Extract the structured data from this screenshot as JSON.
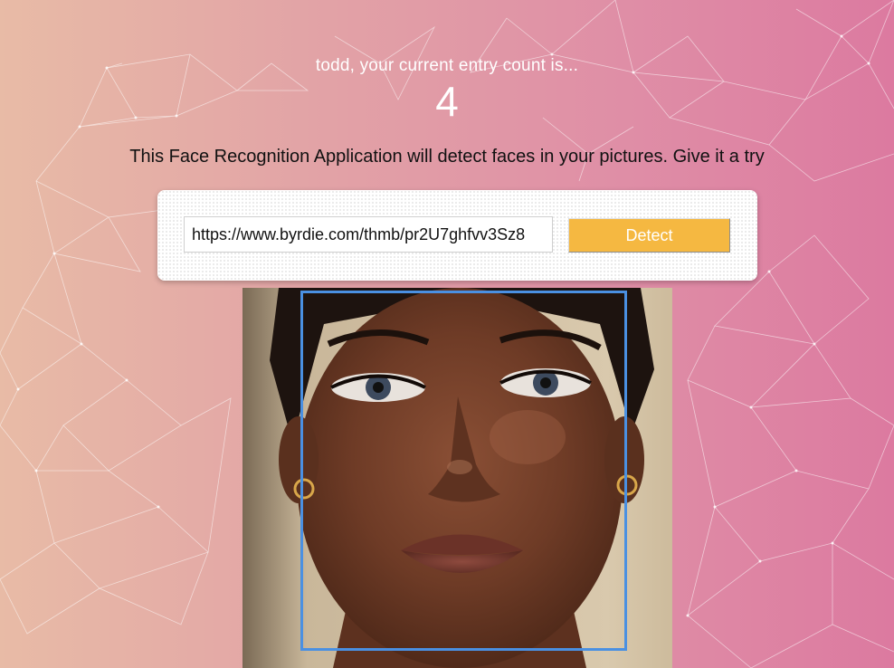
{
  "header": {
    "greeting": "todd, your current entry count is...",
    "entry_count": "4"
  },
  "intro": {
    "text": "This Face Recognition Application will detect faces in your pictures. Give it a try"
  },
  "form": {
    "url_value": "https://www.byrdie.com/thmb/pr2U7ghfvv3Sz8",
    "detect_label": "Detect"
  },
  "colors": {
    "button": "#f5b841",
    "face_box": "#4a90e2"
  }
}
